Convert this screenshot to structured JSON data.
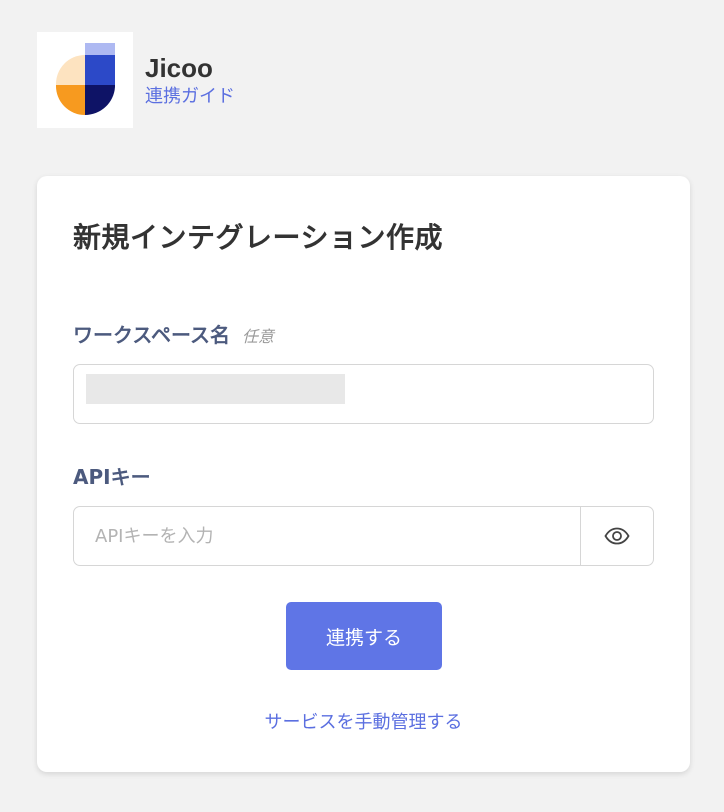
{
  "app": {
    "name": "Jicoo",
    "guide_link": "連携ガイド",
    "logo_icon": "jicoo-logo-icon"
  },
  "form": {
    "title": "新規インテグレーション作成",
    "workspace": {
      "label": "ワークスペース名",
      "optional_tag": "任意",
      "value": ""
    },
    "api_key": {
      "label": "APIキー",
      "placeholder": "APIキーを入力",
      "toggle_icon": "eye-icon"
    },
    "submit_label": "連携する",
    "manual_link": "サービスを手動管理する"
  },
  "colors": {
    "accent": "#5f75e6",
    "link": "#5b6fe0",
    "label": "#4c5a7e",
    "background": "#f2f2f2"
  }
}
